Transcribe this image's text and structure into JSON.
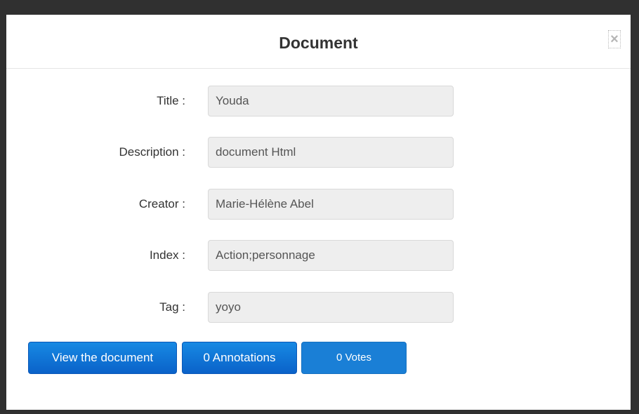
{
  "modal": {
    "title": "Document",
    "close_symbol": "×"
  },
  "fields": [
    {
      "label": "Title :",
      "value": "Youda"
    },
    {
      "label": "Description :",
      "value": "document Html"
    },
    {
      "label": "Creator :",
      "value": "Marie-Hélène Abel"
    },
    {
      "label": "Index :",
      "value": "Action;personnage"
    },
    {
      "label": "Tag :",
      "value": "yoyo"
    }
  ],
  "buttons": {
    "view_document": "View the document",
    "annotations": "0 Annotations",
    "votes": "0 Votes"
  },
  "colors": {
    "primary": "#0a62c9",
    "votes": "#1a7fd6",
    "backdrop": "#303030"
  }
}
